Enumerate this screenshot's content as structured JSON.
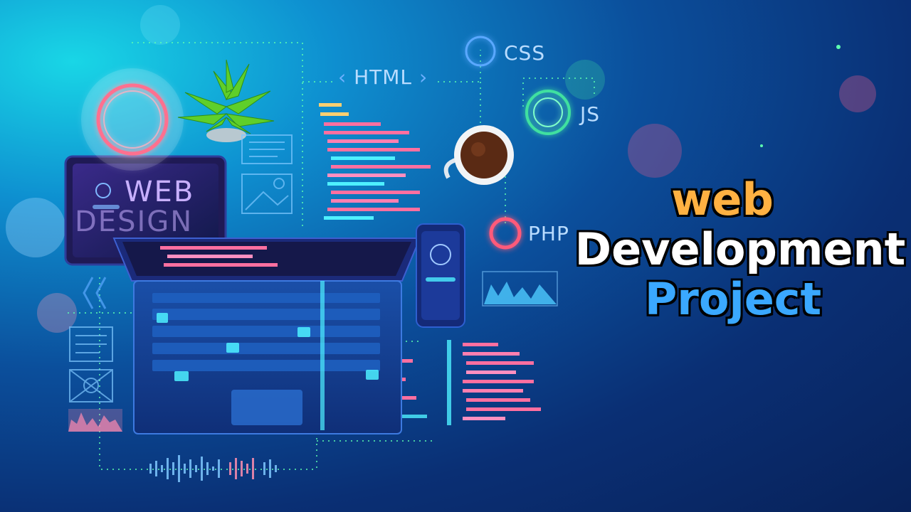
{
  "headline": {
    "line1": "web",
    "line2": "Development",
    "line3": "Project"
  },
  "illustration": {
    "screen_text_line1": "WEB",
    "screen_text_line2": "DESIGN",
    "tag_html": "HTML",
    "tag_html_open": "‹",
    "tag_html_close": "›",
    "tag_css": "CSS",
    "tag_js": "JS",
    "tag_php": "PHP"
  },
  "colors": {
    "headline_web": "#ffb142",
    "headline_development": "#ffffff",
    "headline_project": "#3aa8ff",
    "neon_pink": "#ff5a8a",
    "neon_cyan": "#4ef0ff",
    "neon_green": "#5cffb0"
  }
}
